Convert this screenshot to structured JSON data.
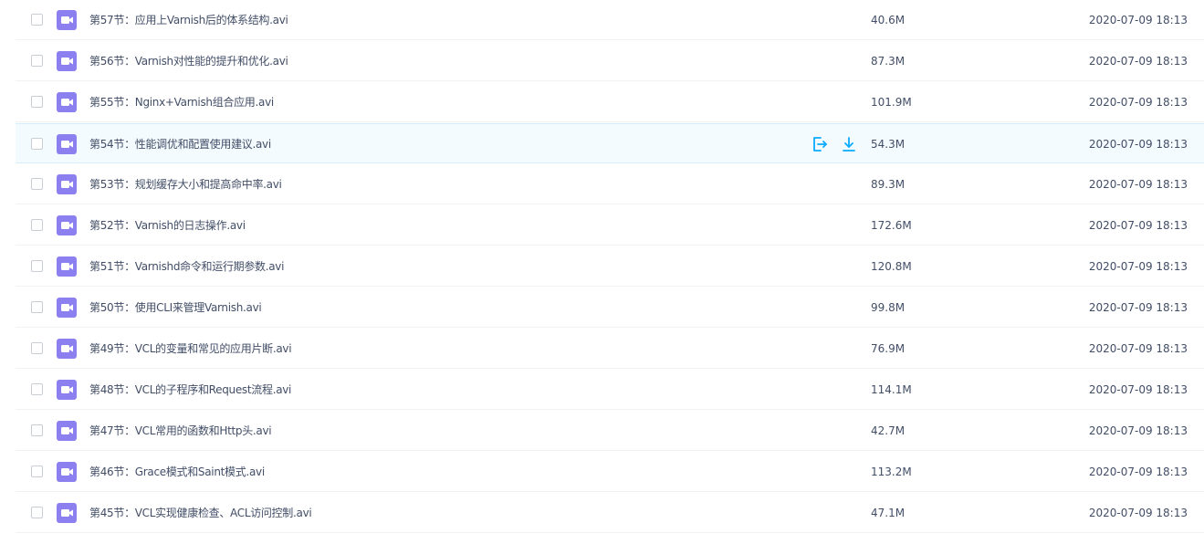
{
  "files": [
    {
      "name": "第57节：应用上Varnish后的体系结构.avi",
      "size": "40.6M",
      "date": "2020-07-09 18:13"
    },
    {
      "name": "第56节：Varnish对性能的提升和优化.avi",
      "size": "87.3M",
      "date": "2020-07-09 18:13"
    },
    {
      "name": "第55节：Nginx+Varnish组合应用.avi",
      "size": "101.9M",
      "date": "2020-07-09 18:13"
    },
    {
      "name": "第54节：性能调优和配置使用建议.avi",
      "size": "54.3M",
      "date": "2020-07-09 18:13"
    },
    {
      "name": "第53节：规划缓存大小和提高命中率.avi",
      "size": "89.3M",
      "date": "2020-07-09 18:13"
    },
    {
      "name": "第52节：Varnish的日志操作.avi",
      "size": "172.6M",
      "date": "2020-07-09 18:13"
    },
    {
      "name": "第51节：Varnishd命令和运行期参数.avi",
      "size": "120.8M",
      "date": "2020-07-09 18:13"
    },
    {
      "name": "第50节：使用CLI来管理Varnish.avi",
      "size": "99.8M",
      "date": "2020-07-09 18:13"
    },
    {
      "name": "第49节：VCL的变量和常见的应用片断.avi",
      "size": "76.9M",
      "date": "2020-07-09 18:13"
    },
    {
      "name": "第48节：VCL的子程序和Request流程.avi",
      "size": "114.1M",
      "date": "2020-07-09 18:13"
    },
    {
      "name": "第47节：VCL常用的函数和Http头.avi",
      "size": "42.7M",
      "date": "2020-07-09 18:13"
    },
    {
      "name": "第46节：Grace模式和Saint模式.avi",
      "size": "113.2M",
      "date": "2020-07-09 18:13"
    },
    {
      "name": "第45节：VCL实现健康检查、ACL访问控制.avi",
      "size": "47.1M",
      "date": "2020-07-09 18:13"
    }
  ],
  "hovered_row": 3,
  "row_actions": [
    {
      "icon": "share-icon"
    },
    {
      "icon": "download-icon"
    }
  ],
  "colors": {
    "video_icon_bg": "#8c7ff0",
    "action_icon": "#09aaff",
    "text": "#424e67",
    "hover_bg": "#f4fbff"
  }
}
